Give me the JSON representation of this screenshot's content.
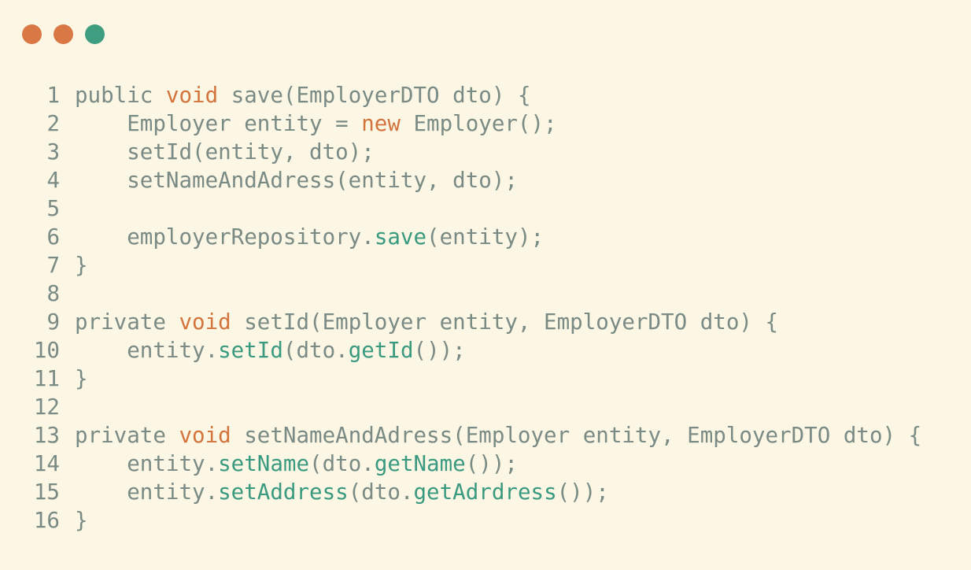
{
  "theme": {
    "background": "#fcf6e4",
    "text": "#7a8a84",
    "keyword": "#d2743c",
    "method": "#3a9a80",
    "dots": [
      "#d97844",
      "#d97844",
      "#3f9e80"
    ]
  },
  "window_controls": [
    {
      "name": "close-dot",
      "color": "#d97844"
    },
    {
      "name": "minimize-dot",
      "color": "#d97844"
    },
    {
      "name": "maximize-dot",
      "color": "#3f9e80"
    }
  ],
  "code": {
    "lines": [
      {
        "num": "1",
        "tokens": [
          [
            "t",
            "public "
          ],
          [
            "k",
            "void"
          ],
          [
            "t",
            " save(EmployerDTO dto) {"
          ]
        ]
      },
      {
        "num": "2",
        "tokens": [
          [
            "t",
            "    Employer entity = "
          ],
          [
            "k",
            "new"
          ],
          [
            "t",
            " Employer();"
          ]
        ]
      },
      {
        "num": "3",
        "tokens": [
          [
            "t",
            "    setId(entity, dto);"
          ]
        ]
      },
      {
        "num": "4",
        "tokens": [
          [
            "t",
            "    setNameAndAdress(entity, dto);"
          ]
        ]
      },
      {
        "num": "5",
        "tokens": []
      },
      {
        "num": "6",
        "tokens": [
          [
            "t",
            "    employerRepository."
          ],
          [
            "f",
            "save"
          ],
          [
            "t",
            "(entity);"
          ]
        ]
      },
      {
        "num": "7",
        "tokens": [
          [
            "t",
            "}"
          ]
        ]
      },
      {
        "num": "8",
        "tokens": []
      },
      {
        "num": "9",
        "tokens": [
          [
            "t",
            "private "
          ],
          [
            "k",
            "void"
          ],
          [
            "t",
            " setId(Employer entity, EmployerDTO dto) {"
          ]
        ]
      },
      {
        "num": "10",
        "tokens": [
          [
            "t",
            "    entity."
          ],
          [
            "f",
            "setId"
          ],
          [
            "t",
            "(dto."
          ],
          [
            "f",
            "getId"
          ],
          [
            "t",
            "());"
          ]
        ]
      },
      {
        "num": "11",
        "tokens": [
          [
            "t",
            "}"
          ]
        ]
      },
      {
        "num": "12",
        "tokens": []
      },
      {
        "num": "13",
        "tokens": [
          [
            "t",
            "private "
          ],
          [
            "k",
            "void"
          ],
          [
            "t",
            " setNameAndAdress(Employer entity, EmployerDTO dto) {"
          ]
        ]
      },
      {
        "num": "14",
        "tokens": [
          [
            "t",
            "    entity."
          ],
          [
            "f",
            "setName"
          ],
          [
            "t",
            "(dto."
          ],
          [
            "f",
            "getName"
          ],
          [
            "t",
            "());"
          ]
        ]
      },
      {
        "num": "15",
        "tokens": [
          [
            "t",
            "    entity."
          ],
          [
            "f",
            "setAddress"
          ],
          [
            "t",
            "(dto."
          ],
          [
            "f",
            "getAdrdress"
          ],
          [
            "t",
            "());"
          ]
        ]
      },
      {
        "num": "16",
        "tokens": [
          [
            "t",
            "}"
          ]
        ]
      }
    ]
  }
}
